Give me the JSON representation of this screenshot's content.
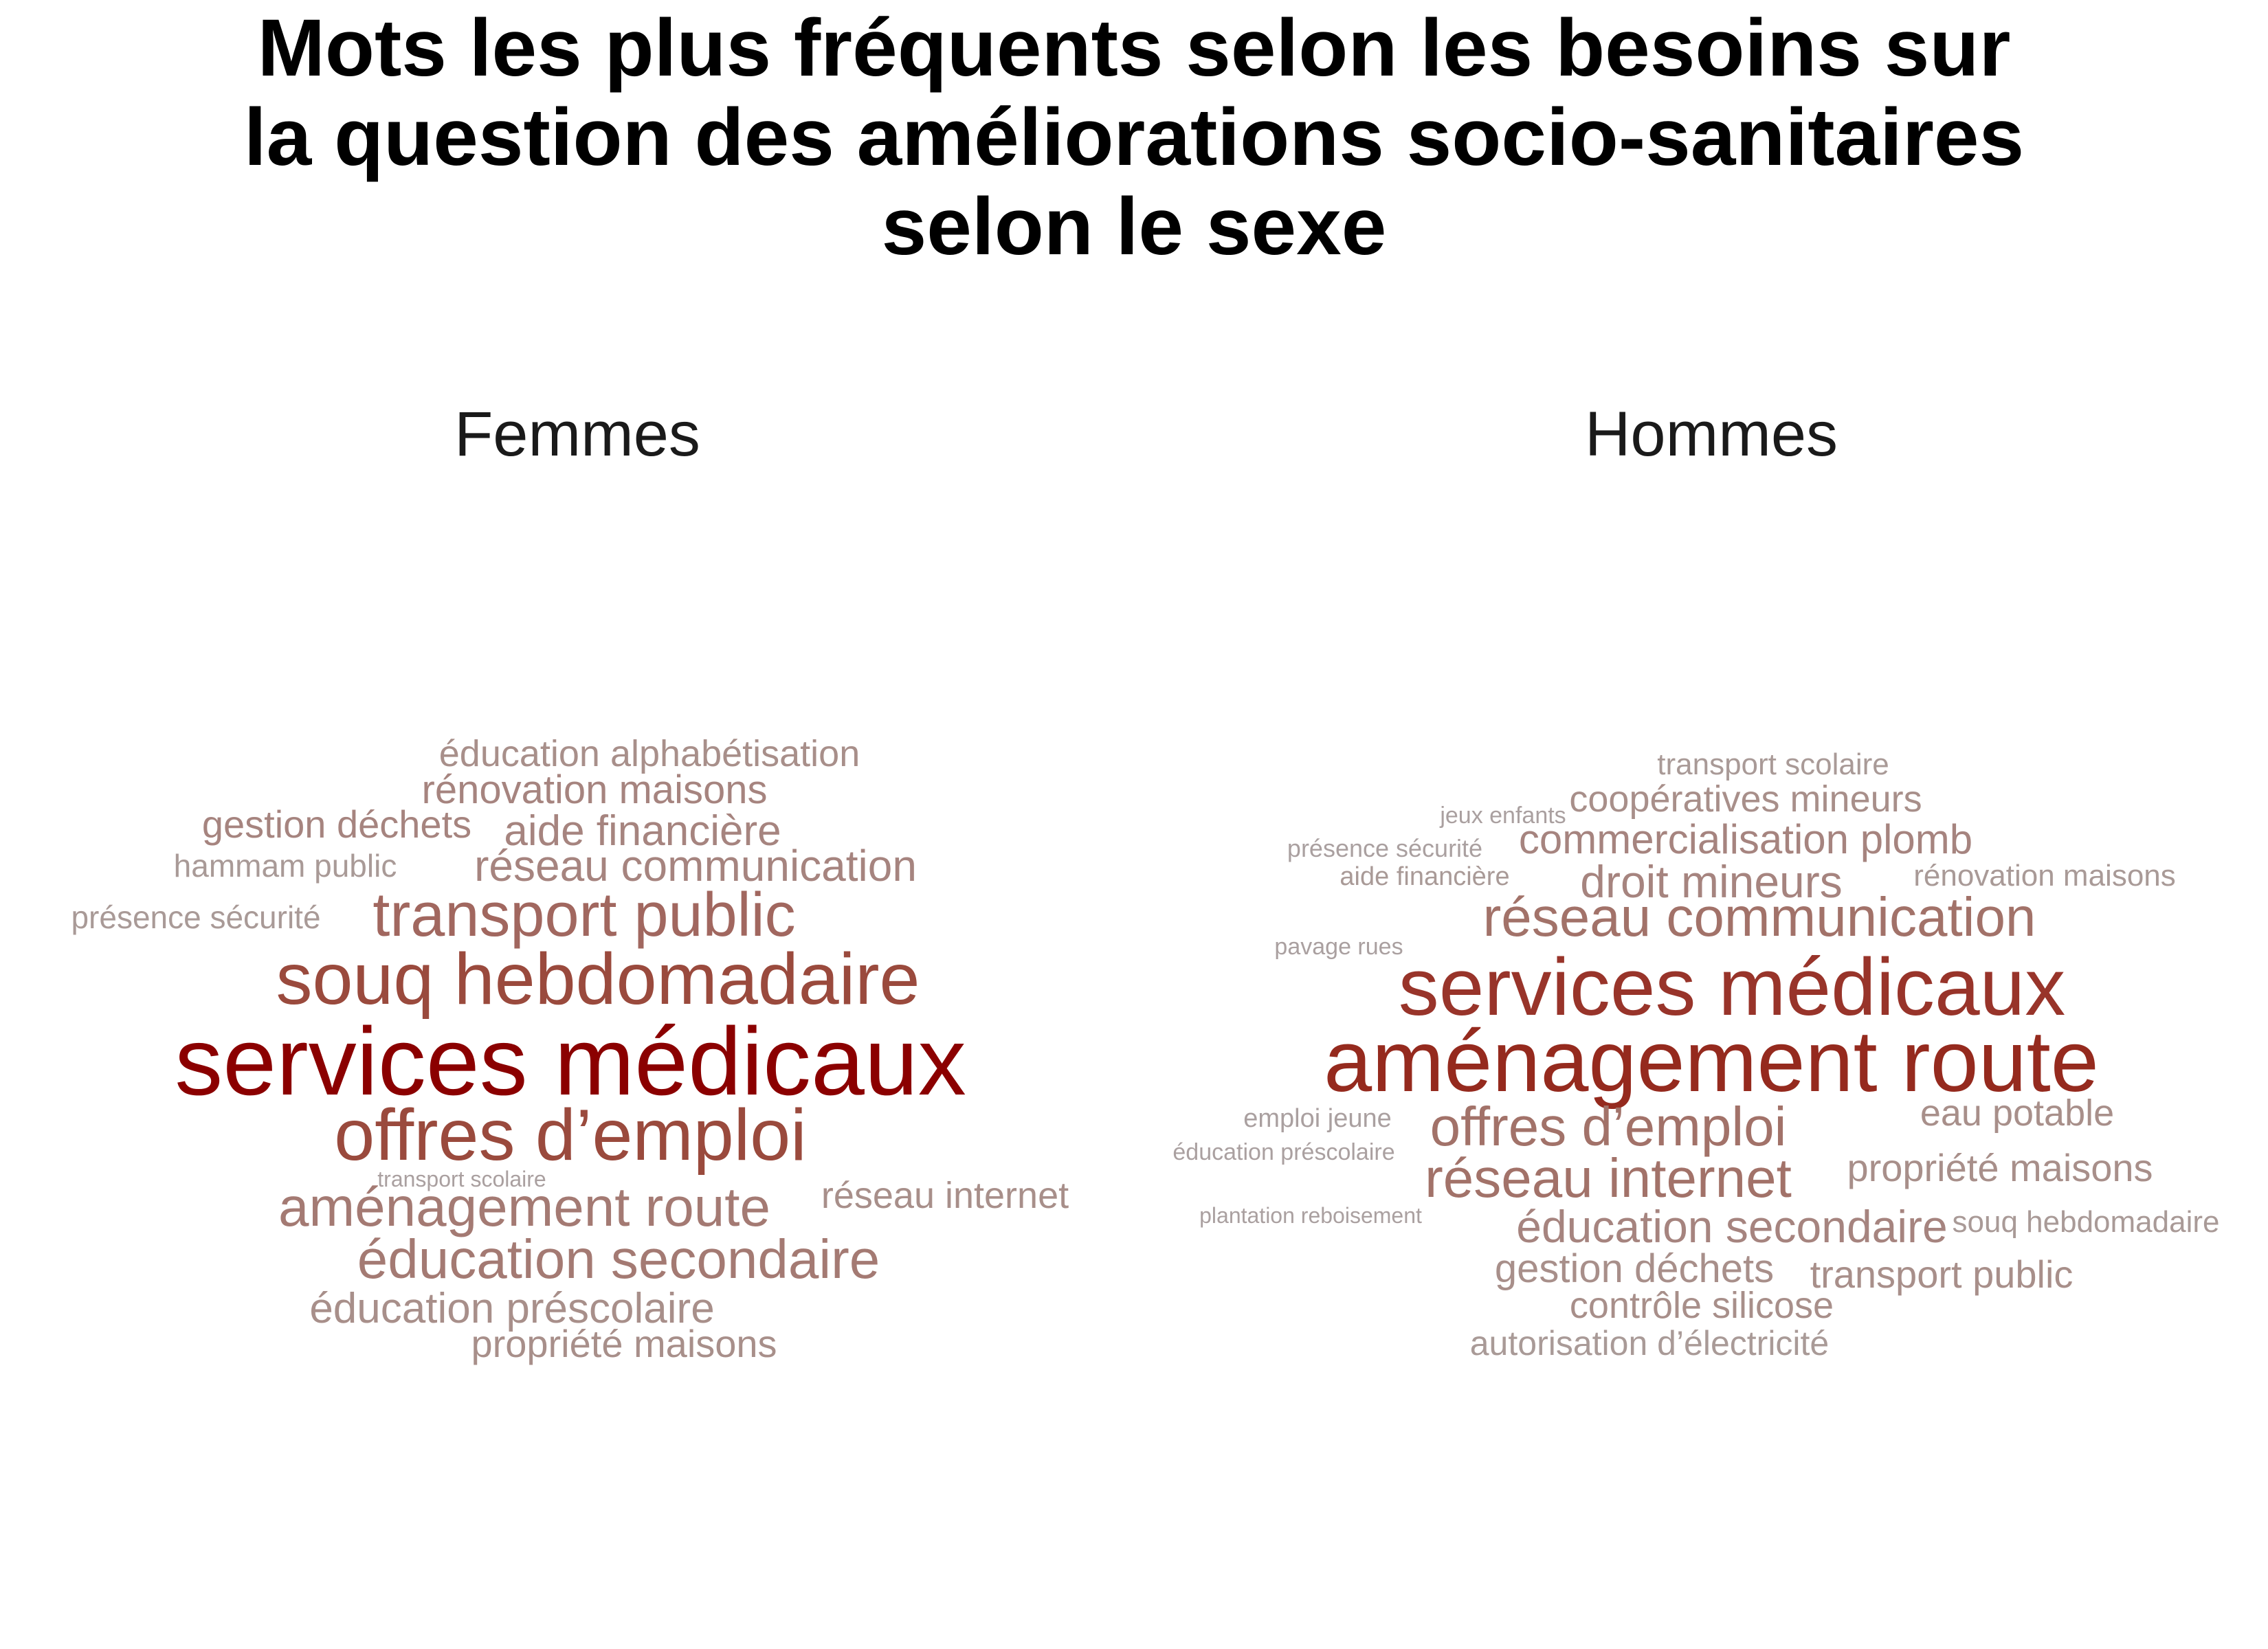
{
  "title": {
    "line1": "Mots les plus fréquents selon les besoins sur",
    "line2": "la question des améliorations socio-sanitaires",
    "line3": "selon le sexe"
  },
  "panels": [
    {
      "label": "Femmes",
      "words": [
        {
          "text": "services médicaux",
          "color": "#8b0000"
        },
        {
          "text": "souq hebdomadaire",
          "color": "#9a4a3d"
        },
        {
          "text": "offres d’emploi",
          "color": "#9a4a3d"
        },
        {
          "text": "transport public",
          "color": "#a1675f"
        },
        {
          "text": "aménagement route",
          "color": "#a47a73"
        },
        {
          "text": "éducation secondaire",
          "color": "#a47a73"
        },
        {
          "text": "réseau communication",
          "color": "#a6847f"
        },
        {
          "text": "aide financière",
          "color": "#a6847f"
        },
        {
          "text": "gestion déchets",
          "color": "#a6847f"
        },
        {
          "text": "rénovation maisons",
          "color": "#a6847f"
        },
        {
          "text": "éducation alphabétisation",
          "color": "#a88f8a"
        },
        {
          "text": "éducation préscolaire",
          "color": "#a88f8a"
        },
        {
          "text": "propriété maisons",
          "color": "#a88f8a"
        },
        {
          "text": "réseau internet",
          "color": "#a88f8a"
        },
        {
          "text": "hammam public",
          "color": "#a99a97"
        },
        {
          "text": "présence sécurité",
          "color": "#a99a97"
        },
        {
          "text": "transport scolaire",
          "color": "#aaa0a0"
        }
      ]
    },
    {
      "label": "Hommes",
      "words": [
        {
          "text": "aménagement route",
          "color": "#952a1e"
        },
        {
          "text": "services médicaux",
          "color": "#98342a"
        },
        {
          "text": "réseau communication",
          "color": "#a27269"
        },
        {
          "text": "offres d’emploi",
          "color": "#a27269"
        },
        {
          "text": "réseau internet",
          "color": "#a27269"
        },
        {
          "text": "droit mineurs",
          "color": "#a6847f"
        },
        {
          "text": "commercialisation plomb",
          "color": "#a6847f"
        },
        {
          "text": "éducation secondaire",
          "color": "#a6847f"
        },
        {
          "text": "coopératives mineurs",
          "color": "#a88f8a"
        },
        {
          "text": "eau potable",
          "color": "#a88f8a"
        },
        {
          "text": "propriété maisons",
          "color": "#a88f8a"
        },
        {
          "text": "gestion déchets",
          "color": "#a88f8a"
        },
        {
          "text": "transport public",
          "color": "#a88f8a"
        },
        {
          "text": "contrôle silicose",
          "color": "#a88f8a"
        },
        {
          "text": "transport scolaire",
          "color": "#a99a97"
        },
        {
          "text": "autorisation d’électricité",
          "color": "#a99a97"
        },
        {
          "text": "souq hebdomadaire",
          "color": "#a99a97"
        },
        {
          "text": "rénovation maisons",
          "color": "#a99a97"
        },
        {
          "text": "aide financière",
          "color": "#a99a97"
        },
        {
          "text": "présence sécurité",
          "color": "#aaa0a0"
        },
        {
          "text": "jeux enfants",
          "color": "#aaa0a0"
        },
        {
          "text": "pavage rues",
          "color": "#aaa0a0"
        },
        {
          "text": "emploi jeune",
          "color": "#aaa0a0"
        },
        {
          "text": "éducation préscolaire",
          "color": "#aaa0a0"
        },
        {
          "text": "plantation reboisement",
          "color": "#aaa0a0"
        }
      ]
    }
  ]
}
